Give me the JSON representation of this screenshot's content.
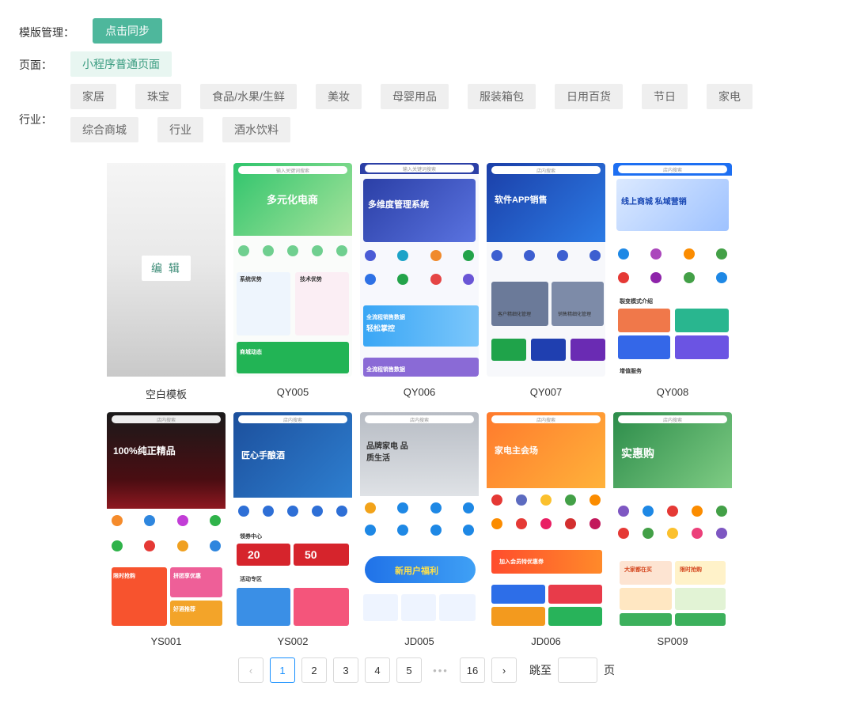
{
  "template_mgmt": {
    "label": "模版管理：",
    "sync_button": "点击同步"
  },
  "page_row": {
    "label": "页面：",
    "option": "小程序普通页面"
  },
  "industry": {
    "label": "行业：",
    "chips": [
      "家居",
      "珠宝",
      "食品/水果/生鲜",
      "美妆",
      "母婴用品",
      "服装箱包",
      "日用百货",
      "节日",
      "家电",
      "综合商城",
      "行业",
      "酒水饮料"
    ]
  },
  "templates": [
    {
      "name": "空白模板",
      "edit_label": "编 辑"
    },
    {
      "name": "QY005",
      "search": "输入关键词搜索",
      "banner_title": "多元化电商",
      "sec_a": "系统优势",
      "sec_b": "技术优势",
      "sec_c": "商城动态"
    },
    {
      "name": "QY006",
      "search": "输入关键词搜索",
      "banner_title": "多维度管理系统",
      "sec_a": "全流程销售数据",
      "sec_b": "轻松掌控",
      "sec_c": "全流程销售数据"
    },
    {
      "name": "QY007",
      "search": "店内搜索",
      "banner_title": "软件APP销售",
      "sec_a": "客户精细化管理",
      "sec_b": "销售精细化管理"
    },
    {
      "name": "QY008",
      "search": "店内搜索",
      "banner_title": "线上商城 私域营销",
      "sec_a": "裂变模式介绍",
      "sec_b": "增值服务"
    },
    {
      "name": "YS001",
      "search": "店内搜索",
      "banner_title": "100%纯正精品",
      "sec_a": "限时抢购",
      "sec_b": "拼团享优惠",
      "sec_c": "好酒推荐"
    },
    {
      "name": "YS002",
      "search": "店内搜索",
      "banner_title": "匠心手酿酒",
      "sec_a": "领券中心",
      "sec_b": "活动专区",
      "coupon_a": "20",
      "coupon_b": "50"
    },
    {
      "name": "JD005",
      "search": "店内搜索",
      "banner_title": "品牌家电 品质生活",
      "sec_a": "新用户福利"
    },
    {
      "name": "JD006",
      "search": "店内搜索",
      "banner_title": "家电主会场",
      "sec_a": "加入会员特优惠券"
    },
    {
      "name": "SP009",
      "search": "店内搜索",
      "banner_title": "实惠购",
      "sec_a": "大家都在买",
      "sec_b": "限时抢购"
    }
  ],
  "pagination": {
    "prev": "‹",
    "next": "›",
    "pages": [
      "1",
      "2",
      "3",
      "4",
      "5"
    ],
    "ellipsis": "•••",
    "last": "16",
    "current": "1",
    "jump_label": "跳至",
    "page_suffix": "页"
  },
  "colors": {
    "primary": "#4eb79c",
    "active_chip_bg": "#e8f6f1",
    "pagination_active": "#1890ff"
  }
}
